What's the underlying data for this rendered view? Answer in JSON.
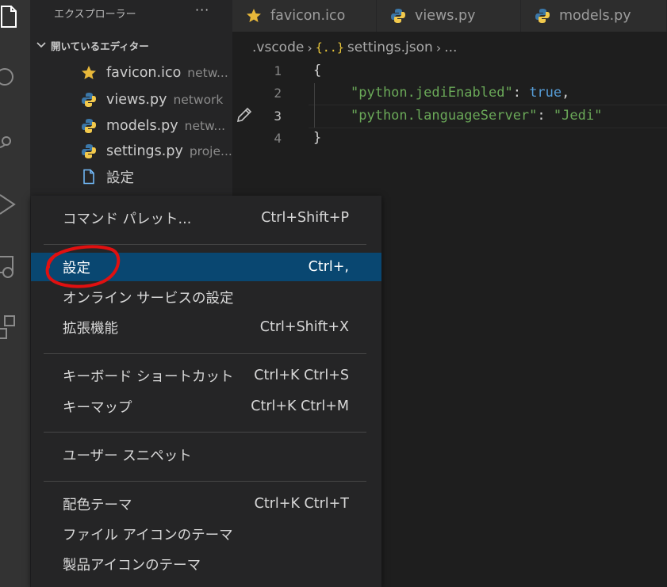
{
  "sidebar": {
    "title": "エクスプローラー",
    "more": "···",
    "section_title": "開いているエディター",
    "open_editors": [
      {
        "name": "favicon.ico",
        "desc": "netw...",
        "icon": "star-icon"
      },
      {
        "name": "views.py",
        "desc": "network",
        "icon": "python-icon"
      },
      {
        "name": "models.py",
        "desc": "netw...",
        "icon": "python-icon"
      },
      {
        "name": "settings.py",
        "desc": "proje...",
        "icon": "python-icon"
      },
      {
        "name": "設定",
        "desc": "",
        "icon": "file-icon"
      }
    ]
  },
  "tabs": [
    {
      "label": "favicon.ico",
      "icon": "star-icon"
    },
    {
      "label": "views.py",
      "icon": "python-icon"
    },
    {
      "label": "models.py",
      "icon": "python-icon"
    }
  ],
  "breadcrumb": {
    "folder": ".vscode",
    "json_icon": "{..}",
    "file": "settings.json",
    "ellipsis": "..."
  },
  "editor": {
    "line_numbers": [
      "1",
      "2",
      "3",
      "4"
    ],
    "line1": "{",
    "line2_key": "\"python.jediEnabled\"",
    "line2_sep": ": ",
    "line2_val": "true",
    "line2_end": ",",
    "line3_key": "\"python.languageServer\"",
    "line3_sep": ": ",
    "line3_val": "\"Jedi\"",
    "line4": "}"
  },
  "menu": {
    "items": [
      {
        "label": "コマンド パレット...",
        "shortcut": "Ctrl+Shift+P"
      },
      {
        "label": "設定",
        "shortcut": "Ctrl+,",
        "selected": true
      },
      {
        "label": "オンライン サービスの設定",
        "shortcut": ""
      },
      {
        "label": "拡張機能",
        "shortcut": "Ctrl+Shift+X"
      },
      {
        "label": "キーボード ショートカット",
        "shortcut": "Ctrl+K Ctrl+S"
      },
      {
        "label": "キーマップ",
        "shortcut": "Ctrl+K Ctrl+M"
      },
      {
        "label": "ユーザー スニペット",
        "shortcut": ""
      },
      {
        "label": "配色テーマ",
        "shortcut": "Ctrl+K Ctrl+T"
      },
      {
        "label": "ファイル アイコンのテーマ",
        "shortcut": ""
      },
      {
        "label": "製品アイコンのテーマ",
        "shortcut": ""
      }
    ]
  },
  "colors": {
    "selection": "#094771",
    "annotation": "#e01010",
    "string": "#6aa858",
    "keyword": "#569cd6",
    "star": "#e8b83a"
  }
}
